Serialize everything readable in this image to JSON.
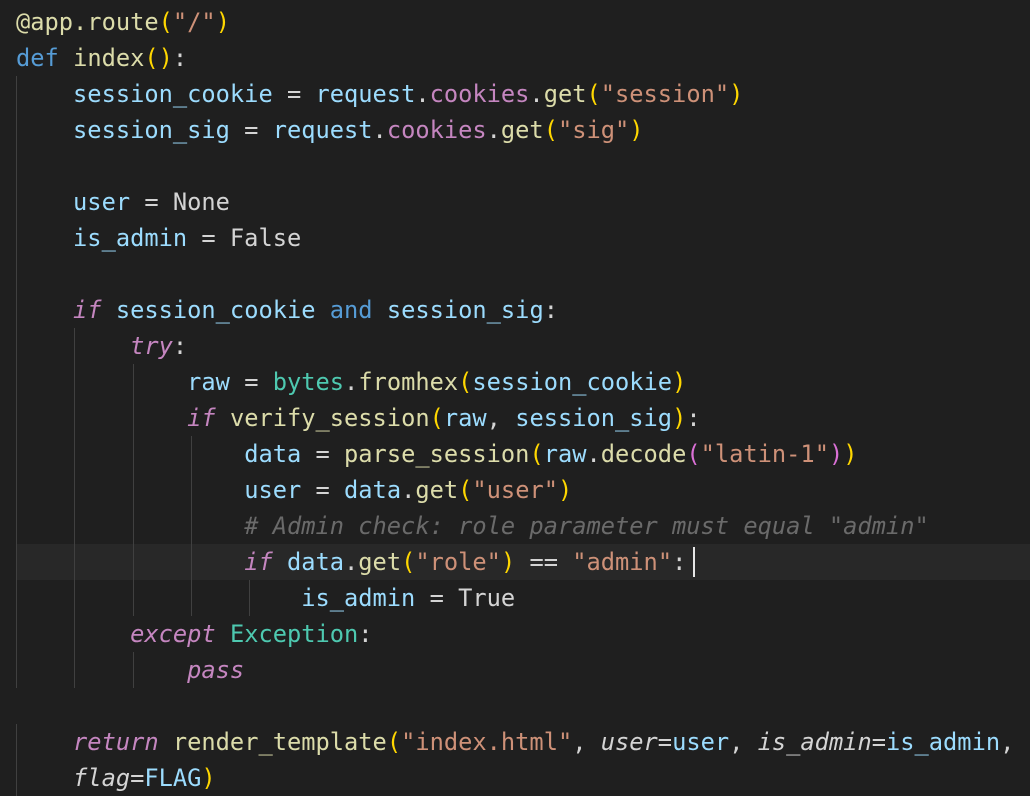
{
  "editor": {
    "language": "python",
    "theme_colors": {
      "background": "#1f1f1f",
      "current_line": "#282828",
      "keyword": "#569cd6",
      "control_keyword": "#c586c0",
      "function": "#dcdcaa",
      "variable": "#9cdcfe",
      "string": "#ce9178",
      "comment": "#6a6a6a",
      "class": "#4ec9b0"
    },
    "lines": [
      [
        {
          "t": "@app.route",
          "c": "deco"
        },
        {
          "t": "(",
          "c": "p1"
        },
        {
          "t": "\"/\"",
          "c": "str"
        },
        {
          "t": ")",
          "c": "p1"
        }
      ],
      [
        {
          "t": "def",
          "c": "k-def"
        },
        {
          "t": " ",
          "c": "op"
        },
        {
          "t": "index",
          "c": "fn"
        },
        {
          "t": "()",
          "c": "p1"
        },
        {
          "t": ":",
          "c": "op"
        }
      ],
      [
        {
          "t": "    ",
          "c": "op"
        },
        {
          "t": "session_cookie",
          "c": "var"
        },
        {
          "t": " = ",
          "c": "op"
        },
        {
          "t": "request",
          "c": "var"
        },
        {
          "t": ".",
          "c": "op"
        },
        {
          "t": "cookies",
          "c": "prop"
        },
        {
          "t": ".",
          "c": "op"
        },
        {
          "t": "get",
          "c": "fn"
        },
        {
          "t": "(",
          "c": "p1"
        },
        {
          "t": "\"session\"",
          "c": "str"
        },
        {
          "t": ")",
          "c": "p1"
        }
      ],
      [
        {
          "t": "    ",
          "c": "op"
        },
        {
          "t": "session_sig",
          "c": "var"
        },
        {
          "t": " = ",
          "c": "op"
        },
        {
          "t": "request",
          "c": "var"
        },
        {
          "t": ".",
          "c": "op"
        },
        {
          "t": "cookies",
          "c": "prop"
        },
        {
          "t": ".",
          "c": "op"
        },
        {
          "t": "get",
          "c": "fn"
        },
        {
          "t": "(",
          "c": "p1"
        },
        {
          "t": "\"sig\"",
          "c": "str"
        },
        {
          "t": ")",
          "c": "p1"
        }
      ],
      [],
      [
        {
          "t": "    ",
          "c": "op"
        },
        {
          "t": "user",
          "c": "var"
        },
        {
          "t": " = None",
          "c": "const"
        }
      ],
      [
        {
          "t": "    ",
          "c": "op"
        },
        {
          "t": "is_admin",
          "c": "var"
        },
        {
          "t": " = False",
          "c": "const"
        }
      ],
      [],
      [
        {
          "t": "    ",
          "c": "op"
        },
        {
          "t": "if",
          "c": "k-flow"
        },
        {
          "t": " ",
          "c": "op"
        },
        {
          "t": "session_cookie",
          "c": "var"
        },
        {
          "t": " ",
          "c": "op"
        },
        {
          "t": "and",
          "c": "k-and"
        },
        {
          "t": " ",
          "c": "op"
        },
        {
          "t": "session_sig",
          "c": "var"
        },
        {
          "t": ":",
          "c": "op"
        }
      ],
      [
        {
          "t": "        ",
          "c": "op"
        },
        {
          "t": "try",
          "c": "k-flow"
        },
        {
          "t": ":",
          "c": "op"
        }
      ],
      [
        {
          "t": "            ",
          "c": "op"
        },
        {
          "t": "raw",
          "c": "var"
        },
        {
          "t": " = ",
          "c": "op"
        },
        {
          "t": "bytes",
          "c": "cls"
        },
        {
          "t": ".",
          "c": "op"
        },
        {
          "t": "fromhex",
          "c": "fn"
        },
        {
          "t": "(",
          "c": "p1"
        },
        {
          "t": "session_cookie",
          "c": "var"
        },
        {
          "t": ")",
          "c": "p1"
        }
      ],
      [
        {
          "t": "            ",
          "c": "op"
        },
        {
          "t": "if",
          "c": "k-flow"
        },
        {
          "t": " ",
          "c": "op"
        },
        {
          "t": "verify_session",
          "c": "fn"
        },
        {
          "t": "(",
          "c": "p1"
        },
        {
          "t": "raw",
          "c": "var"
        },
        {
          "t": ", ",
          "c": "op"
        },
        {
          "t": "session_sig",
          "c": "var"
        },
        {
          "t": ")",
          "c": "p1"
        },
        {
          "t": ":",
          "c": "op"
        }
      ],
      [
        {
          "t": "                ",
          "c": "op"
        },
        {
          "t": "data",
          "c": "var"
        },
        {
          "t": " = ",
          "c": "op"
        },
        {
          "t": "parse_session",
          "c": "fn"
        },
        {
          "t": "(",
          "c": "p1"
        },
        {
          "t": "raw",
          "c": "var"
        },
        {
          "t": ".",
          "c": "op"
        },
        {
          "t": "decode",
          "c": "fn"
        },
        {
          "t": "(",
          "c": "p2"
        },
        {
          "t": "\"latin-1\"",
          "c": "str"
        },
        {
          "t": ")",
          "c": "p2"
        },
        {
          "t": ")",
          "c": "p1"
        }
      ],
      [
        {
          "t": "                ",
          "c": "op"
        },
        {
          "t": "user",
          "c": "var"
        },
        {
          "t": " = ",
          "c": "op"
        },
        {
          "t": "data",
          "c": "var"
        },
        {
          "t": ".",
          "c": "op"
        },
        {
          "t": "get",
          "c": "fn"
        },
        {
          "t": "(",
          "c": "p1"
        },
        {
          "t": "\"user\"",
          "c": "str"
        },
        {
          "t": ")",
          "c": "p1"
        }
      ],
      [
        {
          "t": "                ",
          "c": "op"
        },
        {
          "t": "# Admin check: role parameter must equal \"admin\"",
          "c": "cmt"
        }
      ],
      [
        {
          "t": "                ",
          "c": "op"
        },
        {
          "t": "if",
          "c": "k-flow"
        },
        {
          "t": " ",
          "c": "op"
        },
        {
          "t": "data",
          "c": "var"
        },
        {
          "t": ".",
          "c": "op"
        },
        {
          "t": "get",
          "c": "fn"
        },
        {
          "t": "(",
          "c": "p1"
        },
        {
          "t": "\"role\"",
          "c": "str"
        },
        {
          "t": ")",
          "c": "p1"
        },
        {
          "t": " == ",
          "c": "op"
        },
        {
          "t": "\"admin\"",
          "c": "str"
        },
        {
          "t": ":",
          "c": "op"
        }
      ],
      [
        {
          "t": "                    ",
          "c": "op"
        },
        {
          "t": "is_admin",
          "c": "var"
        },
        {
          "t": " = True",
          "c": "const"
        }
      ],
      [
        {
          "t": "        ",
          "c": "op"
        },
        {
          "t": "except",
          "c": "k-flow"
        },
        {
          "t": " ",
          "c": "op"
        },
        {
          "t": "Exception",
          "c": "cls"
        },
        {
          "t": ":",
          "c": "op"
        }
      ],
      [
        {
          "t": "            ",
          "c": "op"
        },
        {
          "t": "pass",
          "c": "k-flow"
        }
      ],
      [],
      [
        {
          "t": "    ",
          "c": "op"
        },
        {
          "t": "return",
          "c": "k-flow"
        },
        {
          "t": " ",
          "c": "op"
        },
        {
          "t": "render_template",
          "c": "fn"
        },
        {
          "t": "(",
          "c": "p1"
        },
        {
          "t": "\"index.html\"",
          "c": "str"
        },
        {
          "t": ", ",
          "c": "op"
        },
        {
          "t": "user",
          "c": "kw-it"
        },
        {
          "t": "=",
          "c": "op"
        },
        {
          "t": "user",
          "c": "var"
        },
        {
          "t": ", ",
          "c": "op"
        },
        {
          "t": "is_admin",
          "c": "kw-it"
        },
        {
          "t": "=",
          "c": "op"
        },
        {
          "t": "is_admin",
          "c": "var"
        },
        {
          "t": ",",
          "c": "op"
        }
      ],
      [
        {
          "t": "    ",
          "c": "op"
        },
        {
          "t": "flag",
          "c": "kw-it"
        },
        {
          "t": "=",
          "c": "op"
        },
        {
          "t": "FLAG",
          "c": "var"
        },
        {
          "t": ")",
          "c": "p1"
        }
      ]
    ],
    "current_line_index": 15
  }
}
